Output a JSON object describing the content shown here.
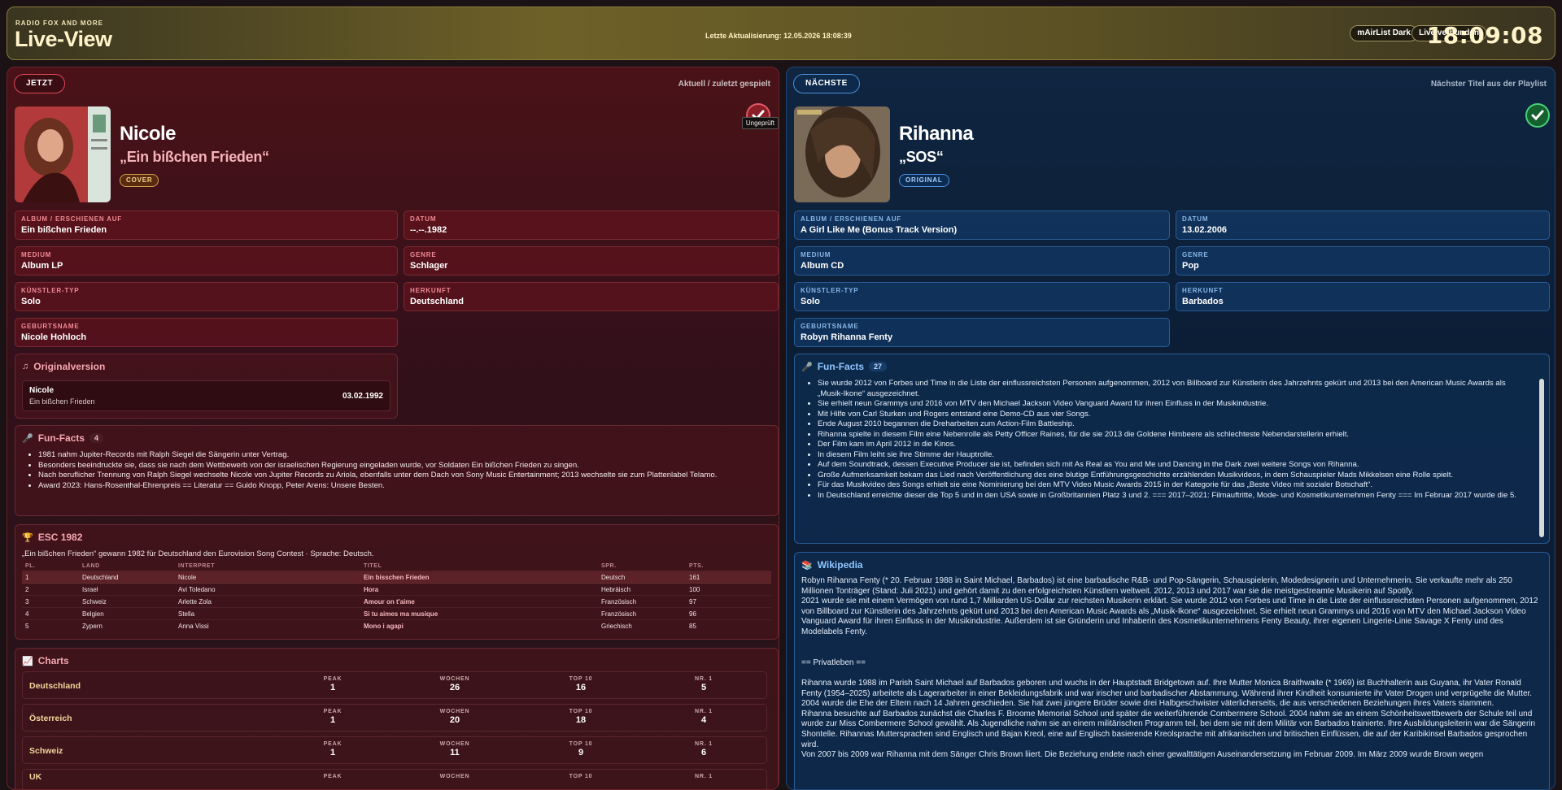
{
  "header": {
    "brand_small": "RADIO FOX AND MORE",
    "brand_big": "Live-View",
    "last_update": "Letzte Aktualisierung: 12.05.2026 18:08:39",
    "theme_label": "mAirList Dark",
    "status_label": "Live verbunden",
    "clock": "18:09:08"
  },
  "now": {
    "tag": "JETZT",
    "hint": "Aktuell / zuletzt gespielt",
    "artist": "Nicole",
    "title": "„Ein bißchen Frieden“",
    "badge": "COVER",
    "check_tooltip": "Ungeprüft",
    "fields": {
      "album_label": "ALBUM / ERSCHIENEN AUF",
      "album": "Ein bißchen Frieden",
      "datum_label": "DATUM",
      "datum": "--.--.1982",
      "medium_label": "MEDIUM",
      "medium": "Album LP",
      "genre_label": "GENRE",
      "genre": "Schlager",
      "typ_label": "KÜNSTLER-TYP",
      "typ": "Solo",
      "herkunft_label": "HERKUNFT",
      "herkunft": "Deutschland",
      "geburt_label": "GEBURTSNAME",
      "geburt": "Nicole Hohloch"
    },
    "original": {
      "title": "Originalversion",
      "artist": "Nicole",
      "song": "Ein bißchen Frieden",
      "date": "03.02.1992"
    },
    "funfacts": {
      "title": "Fun-Facts",
      "count": "4",
      "items": [
        "1981 nahm Jupiter-Records mit Ralph Siegel die Sängerin unter Vertrag.",
        "Besonders beeindruckte sie, dass sie nach dem Wettbewerb von der israelischen Regierung eingeladen wurde, vor Soldaten Ein bißchen Frieden zu singen.",
        "Nach beruflicher Trennung von Ralph Siegel wechselte Nicole von Jupiter Records zu Ariola, ebenfalls unter dem Dach von Sony Music Entertainment; 2013 wechselte sie zum Plattenlabel Telamo.",
        "Award 2023: Hans-Rosenthal-Ehrenpreis == Literatur == Guido Knopp, Peter Arens: Unsere Besten."
      ]
    },
    "esc": {
      "title": "ESC 1982",
      "desc": "„Ein bißchen Frieden“ gewann 1982 für Deutschland den Eurovision Song Contest · Sprache: Deutsch.",
      "headers": [
        "PL.",
        "LAND",
        "INTERPRET",
        "TITEL",
        "SPR.",
        "PTS."
      ],
      "rows": [
        [
          "1",
          "Deutschland",
          "Nicole",
          "Ein bisschen Frieden",
          "Deutsch",
          "161"
        ],
        [
          "2",
          "Israel",
          "Avi Toledano",
          "Hora",
          "Hebräisch",
          "100"
        ],
        [
          "3",
          "Schweiz",
          "Arlette Zola",
          "Amour on t'aime",
          "Französisch",
          "97"
        ],
        [
          "4",
          "Belgien",
          "Stella",
          "Si tu aimes ma musique",
          "Französisch",
          "96"
        ],
        [
          "5",
          "Zypern",
          "Anna Vissi",
          "Mono i agapi",
          "Griechisch",
          "85"
        ]
      ]
    },
    "charts": {
      "title": "Charts",
      "col_labels": [
        "PEAK",
        "WOCHEN",
        "TOP 10",
        "NR. 1"
      ],
      "rows": [
        {
          "country": "Deutschland",
          "vals": [
            "1",
            "26",
            "16",
            "5"
          ]
        },
        {
          "country": "Österreich",
          "vals": [
            "1",
            "20",
            "18",
            "4"
          ]
        },
        {
          "country": "Schweiz",
          "vals": [
            "1",
            "11",
            "9",
            "6"
          ]
        },
        {
          "country": "UK",
          "vals": [
            "",
            "",
            "",
            ""
          ]
        }
      ]
    }
  },
  "next": {
    "tag": "NÄCHSTE",
    "hint": "Nächster Titel aus der Playlist",
    "artist": "Rihanna",
    "title": "„SOS“",
    "badge": "ORIGINAL",
    "fields": {
      "album_label": "ALBUM / ERSCHIENEN AUF",
      "album": "A Girl Like Me (Bonus Track Version)",
      "datum_label": "DATUM",
      "datum": "13.02.2006",
      "medium_label": "MEDIUM",
      "medium": "Album CD",
      "genre_label": "GENRE",
      "genre": "Pop",
      "typ_label": "KÜNSTLER-TYP",
      "typ": "Solo",
      "herkunft_label": "HERKUNFT",
      "herkunft": "Barbados",
      "geburt_label": "GEBURTSNAME",
      "geburt": "Robyn Rihanna Fenty"
    },
    "funfacts": {
      "title": "Fun-Facts",
      "count": "27",
      "items": [
        "Sie wurde 2012 von Forbes und Time in die Liste der einflussreichsten Personen aufgenommen, 2012 von Billboard zur Künstlerin des Jahrzehnts gekürt und 2013 bei den American Music Awards als „Musik-Ikone“ ausgezeichnet.",
        "Sie erhielt neun Grammys und 2016 von MTV den Michael Jackson Video Vanguard Award für ihren Einfluss in der Musikindustrie.",
        "Mit Hilfe von Carl Sturken und Rogers entstand eine Demo-CD aus vier Songs.",
        "Ende August 2010 begannen die Dreharbeiten zum Action-Film Battleship.",
        "Rihanna spielte in diesem Film eine Nebenrolle als Petty Officer Raines, für die sie 2013 die Goldene Himbeere als schlechteste Nebendarstellerin erhielt.",
        "Der Film kam im April 2012 in die Kinos.",
        "In diesem Film leiht sie ihre Stimme der Hauptrolle.",
        "Auf dem Soundtrack, dessen Executive Producer sie ist, befinden sich mit As Real as You and Me und Dancing in the Dark zwei weitere Songs von Rihanna.",
        "Große Aufmerksamkeit bekam das Lied nach Veröffentlichung des eine blutige Entführungsgeschichte erzählenden Musikvideos, in dem Schauspieler Mads Mikkelsen eine Rolle spielt.",
        "Für das Musikvideo des Songs erhielt sie eine Nominierung bei den MTV Video Music Awards 2015 in der Kategorie für das „Beste Video mit sozialer Botschaft“.",
        "In Deutschland erreichte dieser die Top 5 und in den USA sowie in Großbritannien Platz 3 und 2. === 2017–2021: Filmauftritte, Mode- und Kosmetikunternehmen Fenty === Im Februar 2017 wurde die 5."
      ]
    },
    "wiki": {
      "title": "Wikipedia",
      "text": "Robyn Rihanna Fenty (* 20. Februar 1988 in Saint Michael, Barbados) ist eine barbadische R&B- und Pop-Sängerin, Schauspielerin, Modedesignerin und Unternehmerin. Sie verkaufte mehr als 250 Millionen Tonträger (Stand: Juli 2021) und gehört damit zu den erfolgreichsten Künstlern weltweit. 2012, 2013 und 2017 war sie die meistgestreamte Musikerin auf Spotify.\n2021 wurde sie mit einem Vermögen von rund 1,7 Milliarden US-Dollar zur reichsten Musikerin erklärt. Sie wurde 2012 von Forbes und Time in die Liste der einflussreichsten Personen aufgenommen, 2012 von Billboard zur Künstlerin des Jahrzehnts gekürt und 2013 bei den American Music Awards als „Musik-Ikone“ ausgezeichnet. Sie erhielt neun Grammys und 2016 von MTV den Michael Jackson Video Vanguard Award für ihren Einfluss in der Musikindustrie. Außerdem ist sie Gründerin und Inhaberin des Kosmetikunternehmens Fenty Beauty, ihrer eigenen Lingerie-Linie Savage X Fenty und des Modelabels Fenty.\n\n\n== Privatleben ==\n\nRihanna wurde 1988 im Parish Saint Michael auf Barbados geboren und wuchs in der Hauptstadt Bridgetown auf. Ihre Mutter Monica Braithwaite (* 1969) ist Buchhalterin aus Guyana, ihr Vater Ronald Fenty (1954–2025) arbeitete als Lagerarbeiter in einer Bekleidungsfabrik und war irischer und barbadischer Abstammung. Während ihrer Kindheit konsumierte ihr Vater Drogen und verprügelte die Mutter. 2004 wurde die Ehe der Eltern nach 14 Jahren geschieden. Sie hat zwei jüngere Brüder sowie drei Halbgeschwister väterlicherseits, die aus verschiedenen Beziehungen ihres Vaters stammen.\nRihanna besuchte auf Barbados zunächst die Charles F. Broome Memorial School und später die weiterführende Combermere School. 2004 nahm sie an einem Schönheitswettbewerb der Schule teil und wurde zur Miss Combermere School gewählt. Als Jugendliche nahm sie an einem militärischen Programm teil, bei dem sie mit dem Militär von Barbados trainierte. Ihre Ausbildungsleiterin war die Sängerin Shontelle. Rihannas Muttersprachen sind Englisch und Bajan Kreol, eine auf Englisch basierende Kreolsprache mit afrikanischen und britischen Einflüssen, die auf der Karibikinsel Barbados gesprochen wird.\nVon 2007 bis 2009 war Rihanna mit dem Sänger Chris Brown liiert. Die Beziehung endete nach einer gewalttätigen Auseinandersetzung im Februar 2009. Im März 2009 wurde Brown wegen"
    }
  }
}
